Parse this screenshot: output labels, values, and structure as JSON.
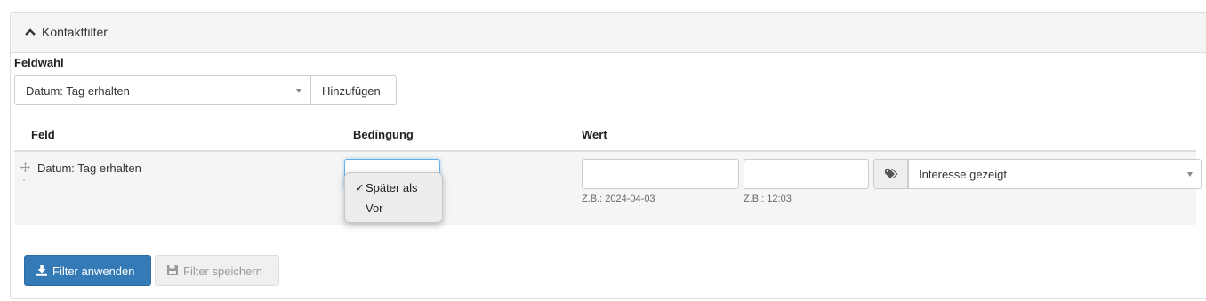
{
  "panel": {
    "title": "Kontaktfilter"
  },
  "feldwahl": {
    "label": "Feldwahl",
    "selected": "Datum: Tag erhalten",
    "add_button": "Hinzufügen"
  },
  "table": {
    "headers": {
      "field": "Feld",
      "condition": "Bedingung",
      "value": "Wert"
    },
    "row": {
      "field": "Datum: Tag erhalten",
      "condition_options": [
        "Später als",
        "Vor"
      ],
      "condition_selected": "Später als",
      "check_mark": "✓",
      "date_value": "",
      "date_hint": "Z.B.: 2024-04-03",
      "time_value": "",
      "time_hint": "Z.B.: 12:03",
      "tag_selected": "Interesse gezeigt"
    }
  },
  "actions": {
    "apply": "Filter anwenden",
    "save": "Filter speichern"
  },
  "colors": {
    "primary": "#337ab7",
    "focus": "#66afe9"
  },
  "icons": [
    "chevron-up-icon",
    "caret-down-icon",
    "move-icon",
    "tags-icon",
    "download-icon",
    "floppy-disk-icon"
  ]
}
